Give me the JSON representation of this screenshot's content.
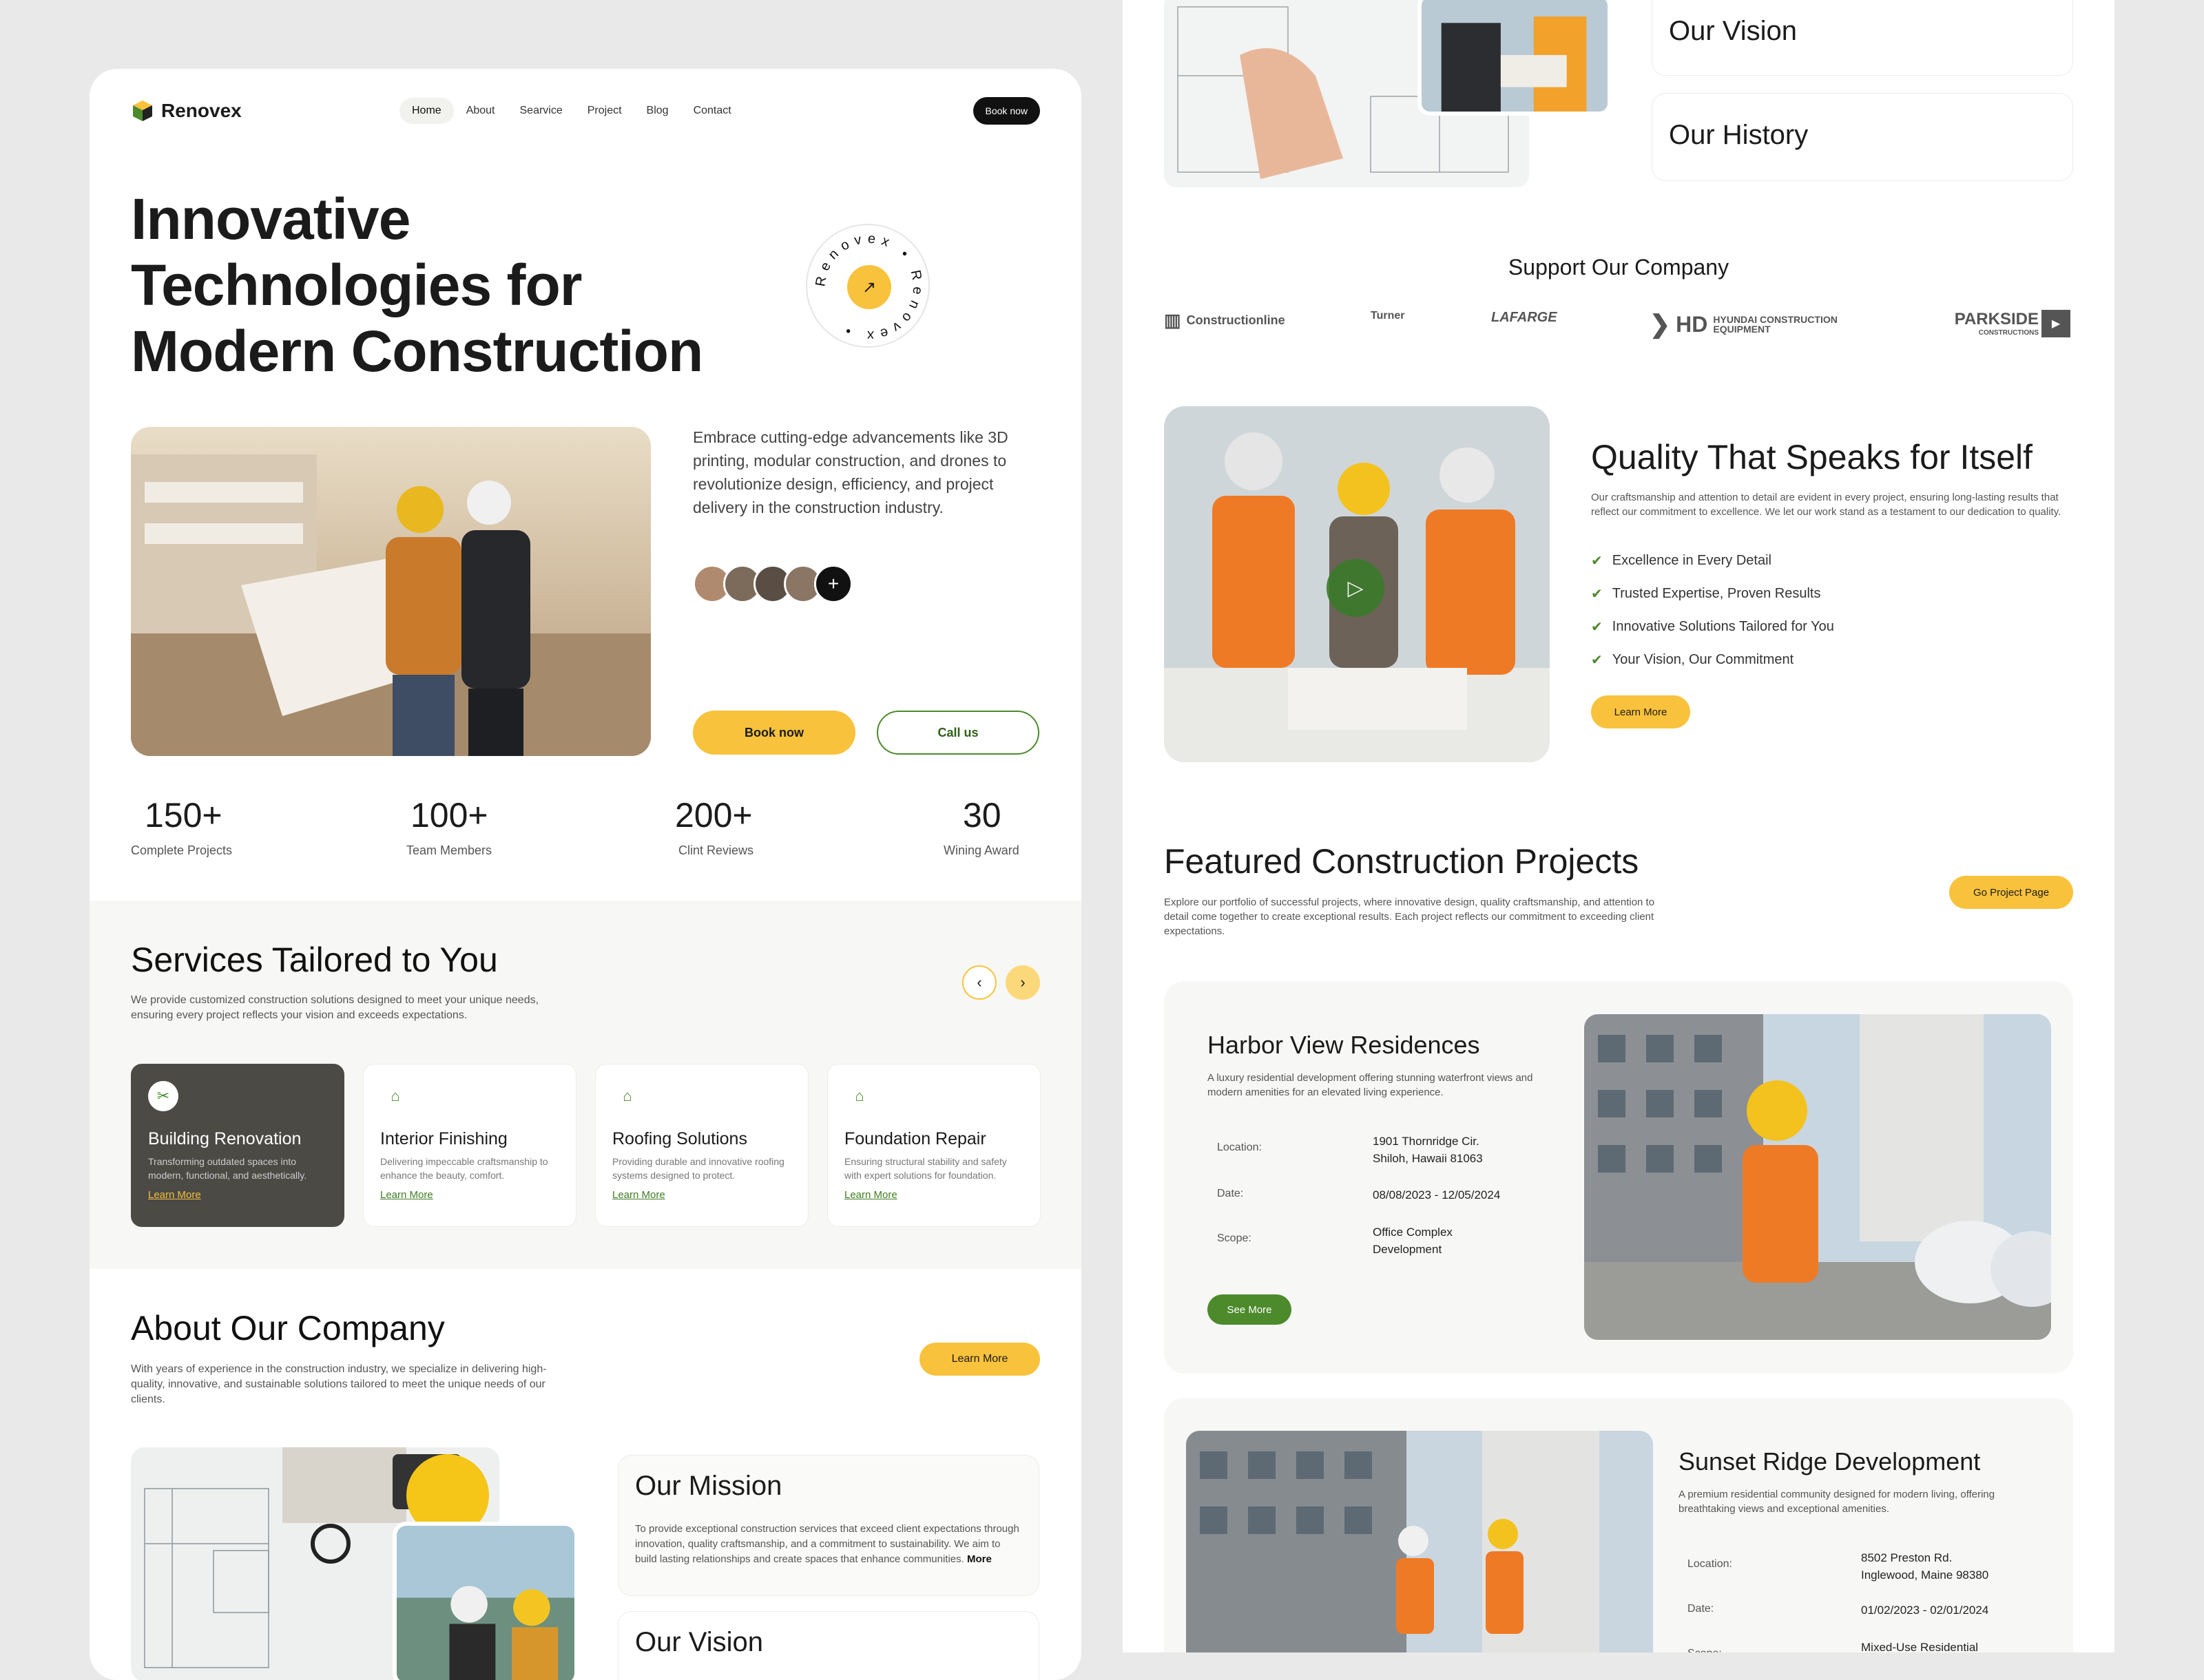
{
  "nav": {
    "brand": "Renovex",
    "links": [
      "Home",
      "About",
      "Searvice",
      "Project",
      "Blog",
      "Contact"
    ],
    "cta": "Book now"
  },
  "hero": {
    "title_lines": [
      "Innovative",
      "Technologies for",
      "Modern Construction"
    ],
    "badge_text": "Renovex • Renovex •",
    "description": "Embrace cutting-edge advancements like 3D printing, modular construction, and drones to revolutionize design, efficiency, and project delivery in the construction industry.",
    "book_btn": "Book now",
    "call_btn": "Call us"
  },
  "stats": [
    {
      "value": "150+",
      "label": "Complete Projects"
    },
    {
      "value": "100+",
      "label": "Team Members"
    },
    {
      "value": "200+",
      "label": "Clint Reviews"
    },
    {
      "value": "30",
      "label": "Wining Award"
    }
  ],
  "services": {
    "title": "Services Tailored to You",
    "description": "We provide customized construction solutions designed to meet your unique needs, ensuring every project reflects your vision and exceeds expectations.",
    "cards": [
      {
        "title": "Building Renovation",
        "desc": "Transforming outdated spaces into modern, functional, and aesthetically.",
        "link": "Learn More",
        "icon": "tools-icon"
      },
      {
        "title": "Interior Finishing",
        "desc": "Delivering impeccable craftsmanship to enhance the beauty, comfort.",
        "link": "Learn More",
        "icon": "home-icon"
      },
      {
        "title": "Roofing Solutions",
        "desc": "Providing durable and innovative roofing systems designed to protect.",
        "link": "Learn More",
        "icon": "roof-icon"
      },
      {
        "title": "Foundation Repair",
        "desc": "Ensuring structural stability and safety with expert solutions for foundation.",
        "link": "Learn More",
        "icon": "foundation-icon"
      }
    ]
  },
  "about": {
    "title": "About Our Company",
    "description": "With years of experience in the construction industry, we specialize in delivering high-quality, innovative, and sustainable solutions tailored to meet the unique needs of our clients.",
    "btn": "Learn More",
    "mission_title": "Our Mission",
    "mission_text": "To provide exceptional construction services that exceed client expectations through innovation, quality craftsmanship, and a commitment to sustainability. We aim to build lasting relationships and create spaces that enhance communities.",
    "mission_more": "More",
    "vision_title": "Our Vision",
    "history_title": "Our History"
  },
  "support": {
    "title": "Support Our Company",
    "brands": [
      "Constructionline",
      "Turner",
      "LAFARGE",
      "HD",
      "HYUNDAI CONSTRUCTION EQUIPMENT",
      "PARKSIDE",
      "CONSTRUCTIONS"
    ]
  },
  "quality": {
    "title": "Quality That Speaks for Itself",
    "description": "Our craftsmanship and attention to detail are evident in every project, ensuring long-lasting results that reflect our commitment to excellence. We let our work stand as a testament to our dedication to quality.",
    "items": [
      "Excellence in Every Detail",
      "Trusted Expertise, Proven Results",
      "Innovative Solutions Tailored for You",
      "Your Vision, Our Commitment"
    ],
    "btn": "Learn More"
  },
  "featured": {
    "title": "Featured Construction Projects",
    "description": "Explore our portfolio of successful projects, where innovative design, quality craftsmanship, and attention to detail come together to create exceptional results. Each project reflects our commitment to exceeding client expectations.",
    "btn": "Go Project Page",
    "labels": {
      "location": "Location:",
      "date": "Date:",
      "scope": "Scope:"
    },
    "projects": [
      {
        "name": "Harbor View Residences",
        "desc": "A luxury residential development offering stunning waterfront views and modern amenities for an elevated living experience.",
        "location_1": "1901 Thornridge Cir.",
        "location_2": "Shiloh, Hawaii 81063",
        "date": "08/08/2023 - 12/05/2024",
        "scope_1": "Office Complex",
        "scope_2": "Development",
        "btn": "See More"
      },
      {
        "name": "Sunset Ridge Development",
        "desc": "A premium residential community designed for modern living, offering breathtaking views and exceptional amenities.",
        "location_1": "8502 Preston Rd.",
        "location_2": "Inglewood, Maine 98380",
        "date": "01/02/2023 - 02/01/2024",
        "scope_1": "Mixed-Use Residential"
      }
    ]
  },
  "colors": {
    "accent": "#f9c23c",
    "green": "#4c8a2b",
    "dark": "#111111"
  }
}
